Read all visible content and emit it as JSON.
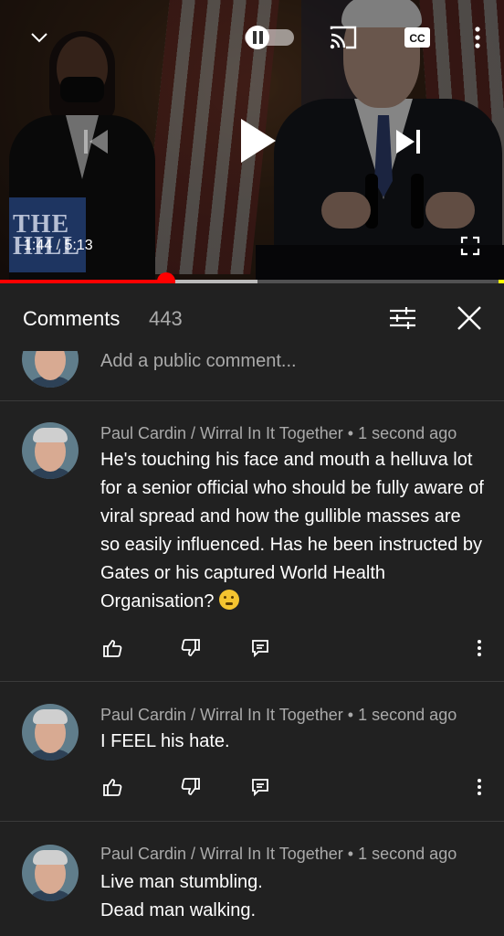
{
  "player": {
    "time_current": "1:44",
    "time_separator": "/",
    "time_total": "5:13",
    "logo_text": "THE\nHILL",
    "progress_played": 0.33,
    "progress_buffered": 0.51,
    "icons": {
      "collapse": "chevron-down-icon",
      "autoplay": "autoplay-toggle-icon",
      "cast": "cast-icon",
      "captions": "cc-icon",
      "more": "more-vertical-icon",
      "previous": "skip-previous-icon",
      "play": "play-icon",
      "next": "skip-next-icon",
      "fullscreen": "fullscreen-icon"
    },
    "colors": {
      "progress": "#ff0000",
      "buffer": "#bbbbbb"
    }
  },
  "comments": {
    "title": "Comments",
    "count": "443",
    "add_placeholder": "Add a public comment...",
    "items": [
      {
        "author": "Paul Cardin / Wirral In It Together",
        "time": "1 second ago",
        "text": "He's touching his face and mouth a helluva lot for a senior official who should be fully aware of viral spread and how the gullible masses are so easily influenced. Has he been instructed by Gates or his captured World Health Organisation?",
        "emoji": "thinking-face-emoji"
      },
      {
        "author": "Paul Cardin / Wirral In It Together",
        "time": "1 second ago",
        "text": "I FEEL his hate."
      },
      {
        "author": "Paul Cardin / Wirral In It Together",
        "time": "1 second ago",
        "text_lines": [
          "Live man stumbling.",
          "Dead man walking."
        ]
      }
    ],
    "meta_separator": "•"
  }
}
